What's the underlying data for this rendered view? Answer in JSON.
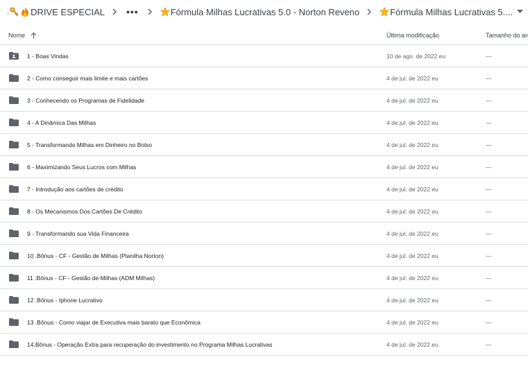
{
  "breadcrumb": {
    "root_label": "DRIVE ESPECIAL",
    "more_label": "•••",
    "folder_label": "Fórmula Milhas Lucrativas 5.0 - Norton Reveno",
    "current_label": "Fórmula Milhas Lucrativas 5...."
  },
  "columns": {
    "name": "Nome",
    "modified": "Última modificação",
    "size": "Tamanho do arq"
  },
  "files": [
    {
      "name": "1 - Boas Vindas",
      "modified": "10 de ago. de 2022 eu",
      "size": "—",
      "shared": true
    },
    {
      "name": "2 - Como conseguir mais limite e mais cartões",
      "modified": "4 de jul. de 2022 eu",
      "size": "—"
    },
    {
      "name": "3 - Conhecendo os Programas de Fidelidade",
      "modified": "4 de jul. de 2022 eu",
      "size": "—"
    },
    {
      "name": "4 - A Dinâmica Das Milhas",
      "modified": "4 de jul. de 2022 eu",
      "size": "—"
    },
    {
      "name": "5 - Transformando Milhas em Dinheiro no Bolso",
      "modified": "4 de jul. de 2022 eu",
      "size": "—"
    },
    {
      "name": "6 - Maximizando Seus Lucros com Milhas",
      "modified": "4 de jul. de 2022 eu",
      "size": "—"
    },
    {
      "name": "7 - Introdução aos cartões de crédito",
      "modified": "4 de jul. de 2022 eu",
      "size": "—"
    },
    {
      "name": "8 - Os Mecanismos Dos Cartões De Crédito",
      "modified": "4 de jul. de 2022 eu",
      "size": "—"
    },
    {
      "name": "9 - Transformando sua Vida Financeira",
      "modified": "4 de jul. de 2022 eu",
      "size": "—"
    },
    {
      "name": "10 .Bônus - CF - Gestão de Milhas (Planilha Norton)",
      "modified": "4 de jul. de 2022 eu",
      "size": "—"
    },
    {
      "name": "11 .Bônus - CF - Gestão de Milhas (ADM Milhas)",
      "modified": "4 de jul. de 2022 eu",
      "size": "—"
    },
    {
      "name": "12 .Bônus - Iphone Lucrativo",
      "modified": "4 de jul. de 2022 eu",
      "size": "—"
    },
    {
      "name": "13 .Bônus - Como viajar de Executiva mais barato que Econômica",
      "modified": "4 de jul. de 2022 eu",
      "size": "—"
    },
    {
      "name": "14.Bônus - Operação Extra para recuperação do investimento no Programa Milhas Lucrativas",
      "modified": "4 de jul. de 2022 eu",
      "size": "—"
    }
  ],
  "icons": {
    "key": "key-icon",
    "fire": "fire-icon",
    "star": "star-icon",
    "folder": "folder-icon",
    "shared_folder": "shared-folder-icon",
    "sort": "arrow-up-icon"
  },
  "colors": {
    "folder": "#5f6368",
    "star": "#fbbc04",
    "fire": "#f57c00",
    "divider": "#dadce0"
  }
}
